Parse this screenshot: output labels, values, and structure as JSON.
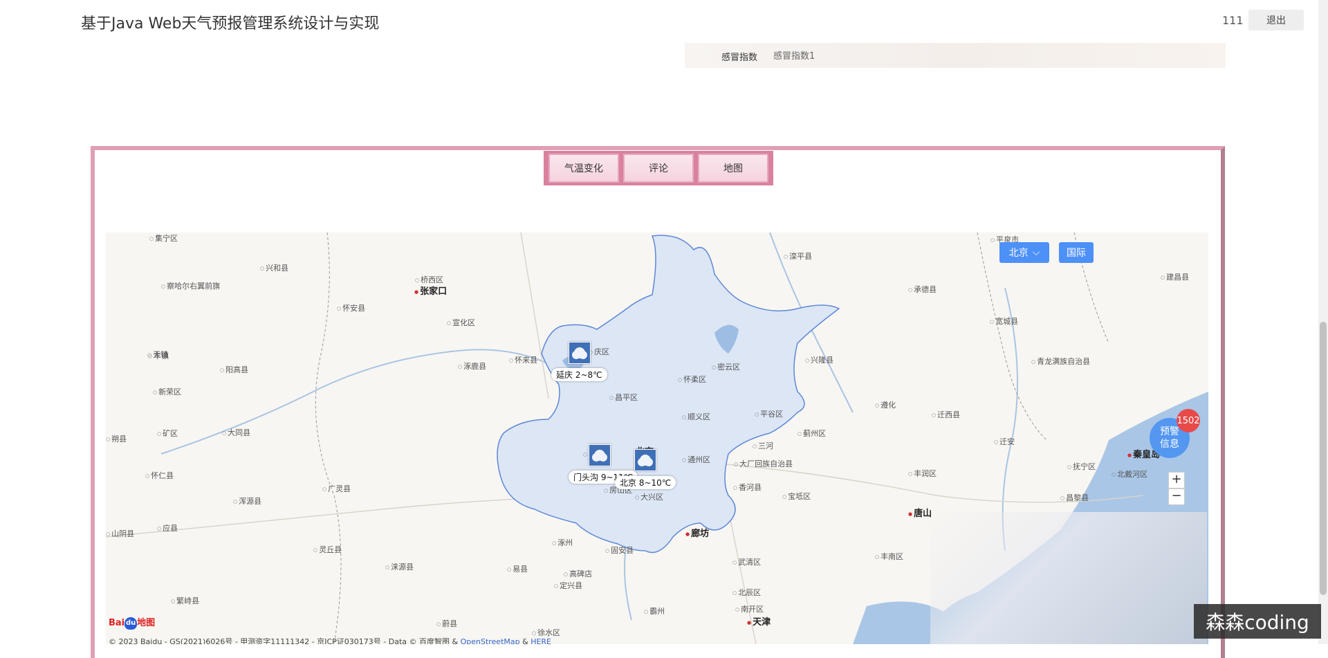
{
  "header": {
    "title": "基于Java Web天气预报管理系统设计与实现",
    "user": "111",
    "logout_label": "退出"
  },
  "flu": {
    "label": "感冒指数",
    "value": "感冒指数1"
  },
  "tabs": [
    {
      "label": "气温变化"
    },
    {
      "label": "评论"
    },
    {
      "label": "地图"
    }
  ],
  "map": {
    "city_select": "北京",
    "intl_label": "国际",
    "warning_label_1": "预警",
    "warning_label_2": "信息",
    "warning_count": "1502",
    "zoom_in": "+",
    "zoom_out": "−",
    "baidu_logo": "Bai",
    "baidu_logo_2": "地图",
    "copyright_text": "© 2023 Baidu - GS(2021)6026号 - 甲测资字11111342 - 京ICP证030173号 - Data © 百度智图 & ",
    "copyright_link1": "OpenStreetMap",
    "copyright_amp": " & ",
    "copyright_link2": "HERE",
    "weather": [
      {
        "label": "延庆 2~8℃"
      },
      {
        "label": "门头沟 9~11℃"
      },
      {
        "label": "北京 8~10℃"
      }
    ],
    "places": [
      "集宁区",
      "兴和县",
      "察哈尔右翼前旗",
      "桥西区",
      "张家口",
      "怀安县",
      "宣化区",
      "丰镇",
      "阳高县",
      "新荣区",
      "涿鹿县",
      "怀来县",
      "庆区",
      "怀柔区",
      "密云区",
      "滦平县",
      "承德县",
      "平泉市",
      "建昌县",
      "宽城县",
      "兴隆县",
      "青龙满族自治县",
      "遵化",
      "迁西县",
      "昌平区",
      "顺义区",
      "平谷区",
      "蓟州区",
      "三河",
      "大厂回族自治县",
      "通州区",
      "香河县",
      "宝坻区",
      "头沟区",
      "北京",
      "房山区",
      "大兴区",
      "廊坊",
      "唐山",
      "丰润区",
      "迁安",
      "抚宁区",
      "北戴河区",
      "秦皇岛",
      "昌黎县",
      "丰南区",
      "武清区",
      "北辰区",
      "南开区",
      "天津",
      "霸州",
      "固安县",
      "涿州",
      "高碑店",
      "定兴县",
      "易县",
      "涞源县",
      "灵丘县",
      "广灵县",
      "浑源县",
      "应县",
      "山阴县",
      "怀仁县",
      "大同县",
      "矿区",
      "朔县",
      "繁峙县",
      "徐水区",
      "天镇",
      "蔚县"
    ]
  },
  "watermark": "森森coding"
}
